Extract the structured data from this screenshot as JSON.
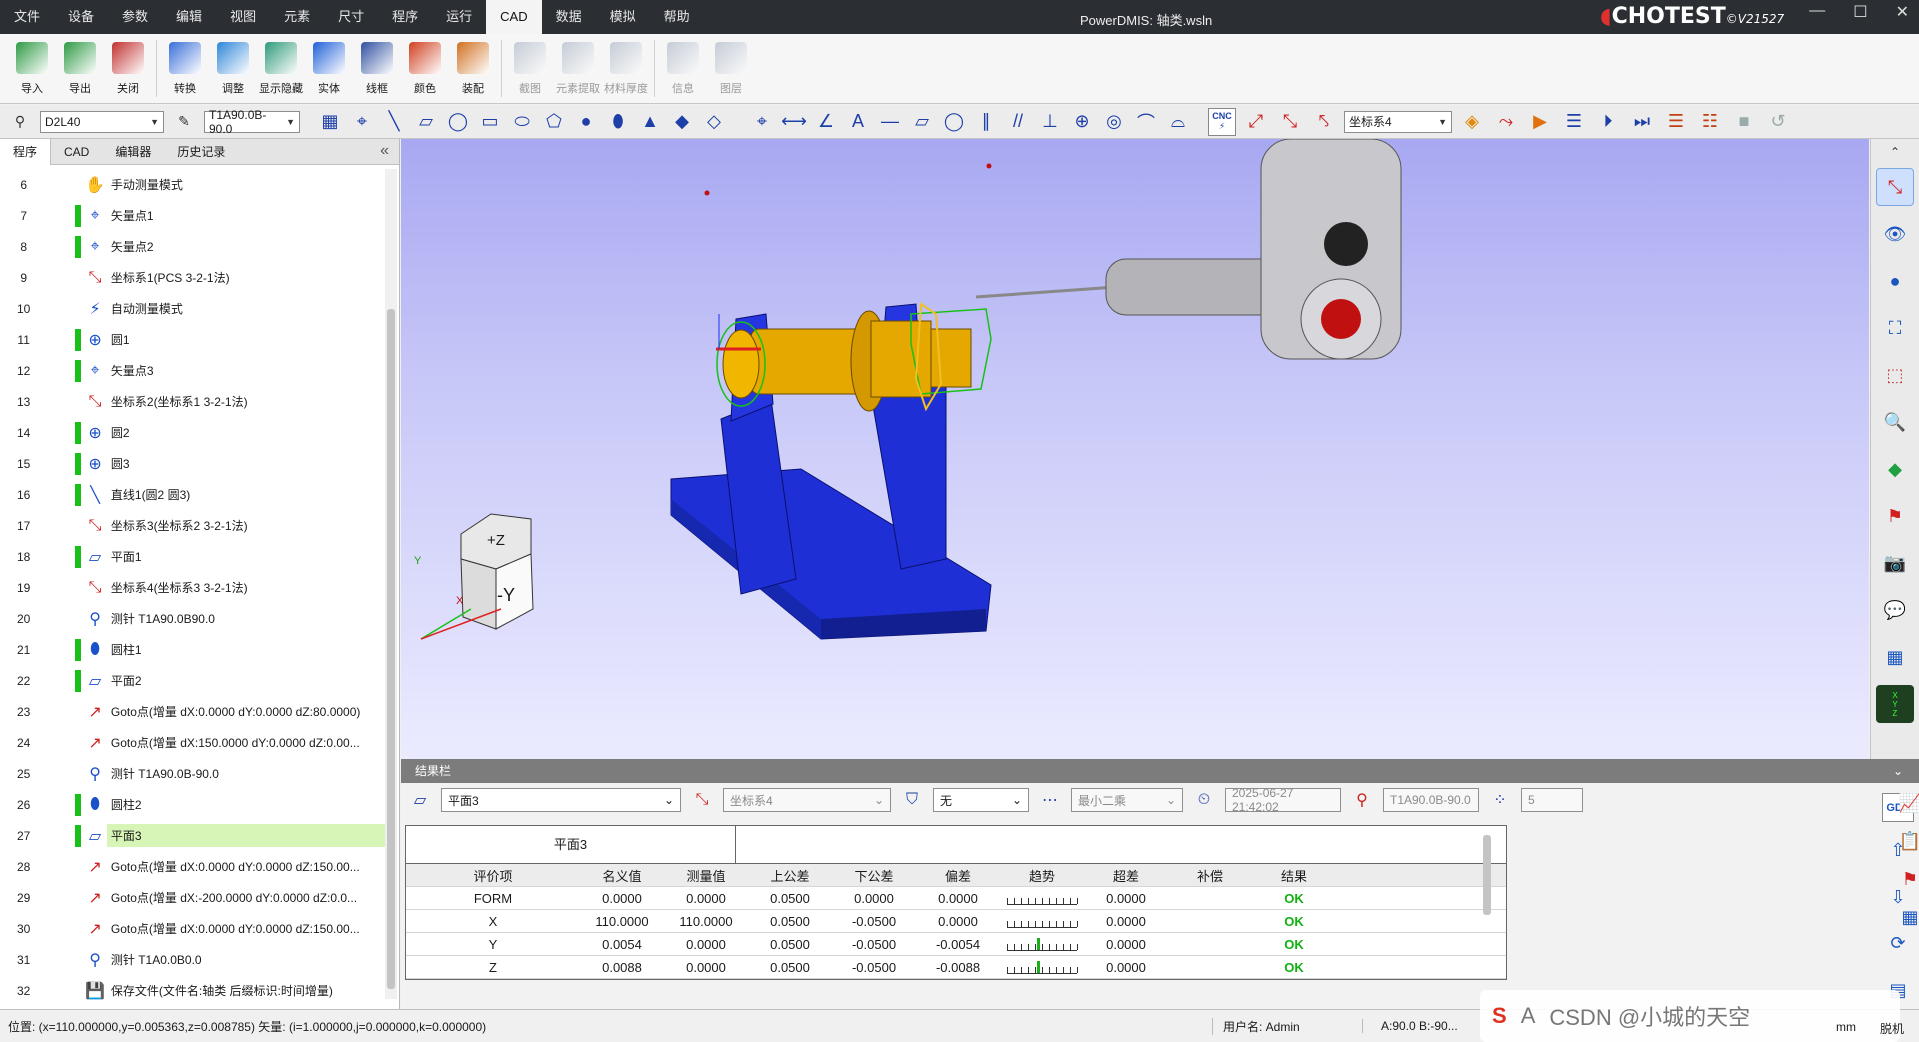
{
  "menu": [
    "文件",
    "设备",
    "参数",
    "编辑",
    "视图",
    "元素",
    "尺寸",
    "程序",
    "运行",
    "CAD",
    "数据",
    "模拟",
    "帮助"
  ],
  "menu_active": "CAD",
  "app_title": "PowerDMIS: 轴类.wsln",
  "logo": {
    "name": "CHOTEST",
    "version": "V21527"
  },
  "window_buttons": [
    "—",
    "☐",
    "✕"
  ],
  "ribbon": [
    {
      "label": "导入",
      "color": "#2e9a44",
      "enabled": true
    },
    {
      "label": "导出",
      "color": "#2e9a44",
      "enabled": true
    },
    {
      "label": "关闭",
      "color": "#c23030",
      "enabled": true
    },
    {
      "label": "转换",
      "color": "#3a6fd8",
      "enabled": true
    },
    {
      "label": "调整",
      "color": "#2e86d8",
      "enabled": true
    },
    {
      "label": "显示隐藏",
      "color": "#2e9a7a",
      "enabled": true
    },
    {
      "label": "实体",
      "color": "#2060d8",
      "enabled": true
    },
    {
      "label": "线框",
      "color": "#3050a0",
      "enabled": true
    },
    {
      "label": "颜色",
      "color": "#d04020",
      "enabled": true
    },
    {
      "label": "装配",
      "color": "#d07020",
      "enabled": true
    },
    {
      "label": "截图",
      "color": "#8a9ab0",
      "enabled": false
    },
    {
      "label": "元素提取",
      "color": "#8a9ab0",
      "enabled": false
    },
    {
      "label": "材料厚度",
      "color": "#8a9ab0",
      "enabled": false
    },
    {
      "label": "信息",
      "color": "#8a9ab0",
      "enabled": false
    },
    {
      "label": "图层",
      "color": "#8a9ab0",
      "enabled": false
    }
  ],
  "toolbar2": {
    "probe_combo": "D2L40",
    "tip_combo": "T1A90.0B-90.0",
    "coord_combo": "坐标系4",
    "icons_left": [
      "plane-grid-icon",
      "point-icon",
      "line-icon",
      "plane-icon",
      "circle-icon",
      "slot-icon",
      "ellipse-icon",
      "polygon-icon",
      "sphere-icon",
      "cylinder-icon",
      "cone-icon",
      "surface-icon",
      "edge-surface-icon"
    ],
    "icons_mid": [
      "crosshair-icon",
      "distance-icon",
      "angle-icon",
      "text-icon",
      "horizontal-icon",
      "parallelogram-icon",
      "circle-icon",
      "parallel-icon",
      "double-slash-icon",
      "perpendicular-icon",
      "position-icon",
      "concentric-icon",
      "arc-icon",
      "profile-icon"
    ],
    "cnc_label": "CNC"
  },
  "left_tabs": [
    "程序",
    "CAD",
    "编辑器",
    "历史记录"
  ],
  "left_tab_active": "程序",
  "program": [
    {
      "n": "6",
      "t": "手动测量模式",
      "icon": "hand-icon",
      "bar": "",
      "sel": false
    },
    {
      "n": "7",
      "t": "矢量点1",
      "icon": "vector-point-icon",
      "bar": "#19c019",
      "sel": false
    },
    {
      "n": "8",
      "t": "矢量点2",
      "icon": "vector-point-icon",
      "bar": "#19c019",
      "sel": false
    },
    {
      "n": "9",
      "t": "坐标系1(PCS  3-2-1法)",
      "icon": "coordinate-system-icon",
      "bar": "",
      "sel": false
    },
    {
      "n": "10",
      "t": "自动测量模式",
      "icon": "cnc-icon",
      "bar": "",
      "sel": false
    },
    {
      "n": "11",
      "t": "圆1",
      "icon": "circle-icon",
      "bar": "#19c019",
      "sel": false
    },
    {
      "n": "12",
      "t": "矢量点3",
      "icon": "vector-point-icon",
      "bar": "#19c019",
      "sel": false
    },
    {
      "n": "13",
      "t": "坐标系2(坐标系1  3-2-1法)",
      "icon": "coordinate-system-icon",
      "bar": "",
      "sel": false
    },
    {
      "n": "14",
      "t": "圆2",
      "icon": "circle-icon",
      "bar": "#19c019",
      "sel": false
    },
    {
      "n": "15",
      "t": "圆3",
      "icon": "circle-icon",
      "bar": "#19c019",
      "sel": false
    },
    {
      "n": "16",
      "t": "直线1(圆2  圆3)",
      "icon": "line-icon",
      "bar": "#19c019",
      "sel": false
    },
    {
      "n": "17",
      "t": "坐标系3(坐标系2  3-2-1法)",
      "icon": "coordinate-system-icon",
      "bar": "",
      "sel": false
    },
    {
      "n": "18",
      "t": "平面1",
      "icon": "plane-icon",
      "bar": "#19c019",
      "sel": false
    },
    {
      "n": "19",
      "t": "坐标系4(坐标系3  3-2-1法)",
      "icon": "coordinate-system-icon",
      "bar": "",
      "sel": false
    },
    {
      "n": "20",
      "t": "测针 T1A90.0B90.0",
      "icon": "probe-icon",
      "bar": "",
      "sel": false
    },
    {
      "n": "21",
      "t": "圆柱1",
      "icon": "cylinder-icon",
      "bar": "#19c019",
      "sel": false
    },
    {
      "n": "22",
      "t": "平面2",
      "icon": "plane-icon",
      "bar": "#19c019",
      "sel": false
    },
    {
      "n": "23",
      "t": "Goto点(增量 dX:0.0000 dY:0.0000 dZ:80.0000)",
      "icon": "goto-icon",
      "bar": "",
      "sel": false
    },
    {
      "n": "24",
      "t": "Goto点(增量 dX:150.0000 dY:0.0000 dZ:0.00...",
      "icon": "goto-icon",
      "bar": "",
      "sel": false
    },
    {
      "n": "25",
      "t": "测针 T1A90.0B-90.0",
      "icon": "probe-icon",
      "bar": "",
      "sel": false
    },
    {
      "n": "26",
      "t": "圆柱2",
      "icon": "cylinder-icon",
      "bar": "#19c019",
      "sel": false
    },
    {
      "n": "27",
      "t": "平面3",
      "icon": "plane-icon",
      "bar": "#19c019",
      "sel": true
    },
    {
      "n": "28",
      "t": "Goto点(增量 dX:0.0000 dY:0.0000 dZ:150.00...",
      "icon": "goto-icon",
      "bar": "",
      "sel": false
    },
    {
      "n": "29",
      "t": "Goto点(增量 dX:-200.0000 dY:0.0000 dZ:0.0...",
      "icon": "goto-icon",
      "bar": "",
      "sel": false
    },
    {
      "n": "30",
      "t": "Goto点(增量 dX:0.0000 dY:0.0000 dZ:150.00...",
      "icon": "goto-icon",
      "bar": "",
      "sel": false
    },
    {
      "n": "31",
      "t": "测针 T1A0.0B0.0",
      "icon": "probe-icon",
      "bar": "",
      "sel": false
    },
    {
      "n": "32",
      "t": "保存文件(文件名:轴类 后缀标识:时间增量)",
      "icon": "save-icon",
      "bar": "",
      "sel": false
    }
  ],
  "viewcube": {
    "top": "+Z",
    "front": "-Y",
    "axis_x": "X",
    "axis_y": "Y"
  },
  "results": {
    "header": "结果栏",
    "feature_combo": "平面3",
    "coord_combo": "坐标系4",
    "filter_combo": "无",
    "method_combo": "最小二乘",
    "datetime": "2025-06-27 21:42:02",
    "tip": "T1A90.0B-90.0",
    "points": "5",
    "table_title": "平面3",
    "columns": [
      "评价项",
      "名义值",
      "测量值",
      "上公差",
      "下公差",
      "偏差",
      "趋势",
      "超差",
      "补偿",
      "结果"
    ],
    "rows": [
      {
        "item": "FORM",
        "nominal": "0.0000",
        "measured": "0.0000",
        "upper": "0.0500",
        "lower": "0.0000",
        "dev": "0.0000",
        "trend": 0,
        "out": "0.0000",
        "comp": "",
        "result": "OK"
      },
      {
        "item": "X",
        "nominal": "110.0000",
        "measured": "110.0000",
        "upper": "0.0500",
        "lower": "-0.0500",
        "dev": "0.0000",
        "trend": 0,
        "out": "0.0000",
        "comp": "",
        "result": "OK"
      },
      {
        "item": "Y",
        "nominal": "0.0054",
        "measured": "0.0000",
        "upper": "0.0500",
        "lower": "-0.0500",
        "dev": "-0.0054",
        "trend": 1,
        "out": "0.0000",
        "comp": "",
        "result": "OK"
      },
      {
        "item": "Z",
        "nominal": "0.0088",
        "measured": "0.0000",
        "upper": "0.0500",
        "lower": "-0.0500",
        "dev": "-0.0088",
        "trend": 1,
        "out": "0.0000",
        "comp": "",
        "result": "OK"
      }
    ],
    "side_buttons": [
      "GDT"
    ]
  },
  "status": {
    "position": "位置: (x=110.000000,y=0.005363,z=0.008785)  矢量: (i=1.000000,j=0.000000,k=0.000000)",
    "user": "用户名: Admin",
    "angle": "A:90.0  B:-90..."
  },
  "watermark": {
    "text": "CSDN @小城的天空",
    "chars": [
      "S",
      "A",
      "mm",
      "脱机"
    ]
  },
  "colors": {
    "menubar": "#2b2f33",
    "accent_blue": "#1a56c0",
    "ok_green": "#12b012",
    "fixture_blue": "#1f2fd6",
    "part_gold": "#e4a800",
    "selected_row": "#d8f5b8"
  }
}
